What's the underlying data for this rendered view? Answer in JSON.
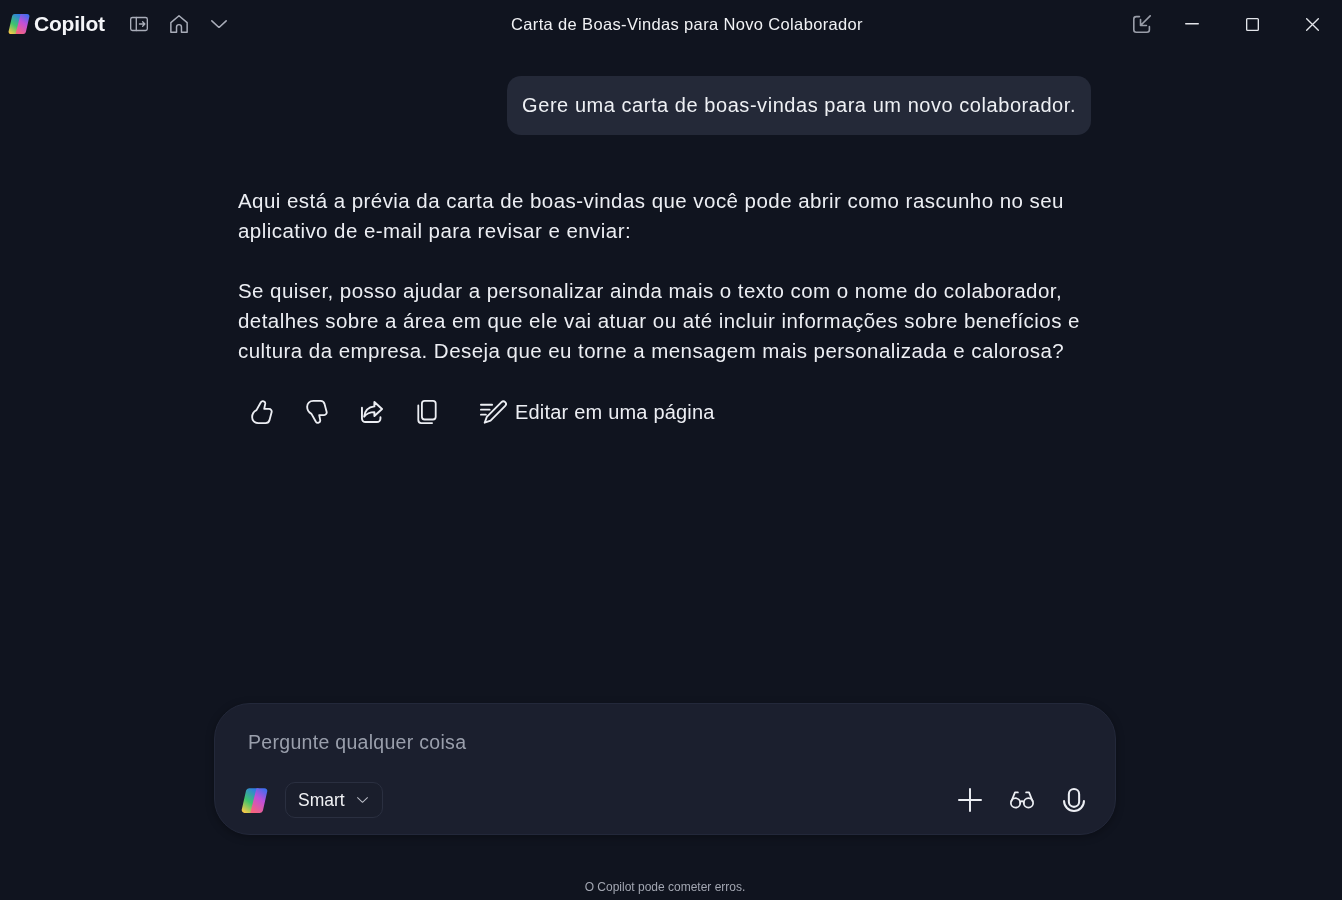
{
  "window": {
    "app_name": "Copilot",
    "title": "Carta de Boas-Vindas para Novo Colaborador"
  },
  "conversation": [
    {
      "kind": "user",
      "text": "Gere uma carta de boas-vindas para um novo colaborador."
    },
    {
      "kind": "assistant",
      "paragraphs": [
        "Aqui está a prévia da carta de boas-vindas que você pode abrir como rascunho no seu aplicativo de e-mail para revisar e enviar:",
        "Se quiser, posso ajudar a personalizar ainda mais o texto com o nome do colaborador, detalhes sobre a área em que ele vai atuar ou até incluir informações sobre benefícios e cultura da empresa. Deseja que eu torne a mensagem mais personalizada e calorosa?"
      ],
      "edit_label": "Editar em uma página"
    }
  ],
  "composer": {
    "placeholder": "Pergunte qualquer coisa",
    "mode": "Smart"
  },
  "footer": {
    "disclaimer": "O Copilot pode cometer erros."
  }
}
